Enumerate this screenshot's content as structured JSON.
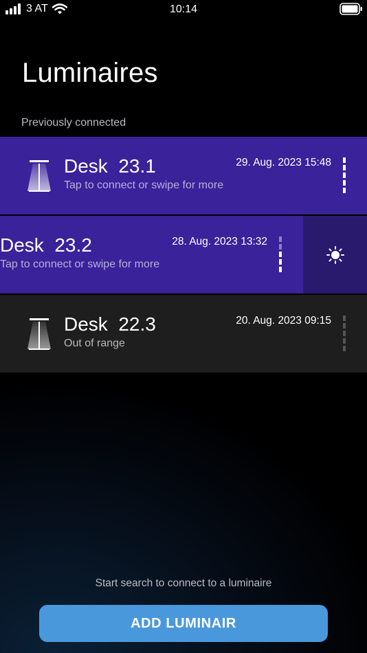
{
  "status_bar": {
    "carrier": "3 AT",
    "time": "10:14"
  },
  "page": {
    "title": "Luminaires",
    "section_label": "Previously connected"
  },
  "colors": {
    "connected_row": "#3a229a",
    "offline_row": "#1e1e1e",
    "accent_button": "#4a98dc",
    "swipe_action": "#2a1a6e"
  },
  "luminaires": [
    {
      "name": "Desk  23.1",
      "subtitle": "Tap to connect or swipe for more",
      "date": "29. Aug. 2023 15:48",
      "status": "connectable",
      "icon": "desk-lamp-icon"
    },
    {
      "name": "Desk  23.2",
      "subtitle": "Tap to connect or swipe for more",
      "date": "28. Aug. 2023 13:32",
      "status": "connectable",
      "swiped": true,
      "swipe_action_icon": "brightness-icon"
    },
    {
      "name": "Desk  22.3",
      "subtitle": "Out of range",
      "date": "20. Aug. 2023 09:15",
      "status": "out-of-range",
      "icon": "desk-lamp-icon"
    }
  ],
  "footer": {
    "hint": "Start search to connect to a luminaire",
    "add_button_label": "ADD LUMINAIR"
  }
}
